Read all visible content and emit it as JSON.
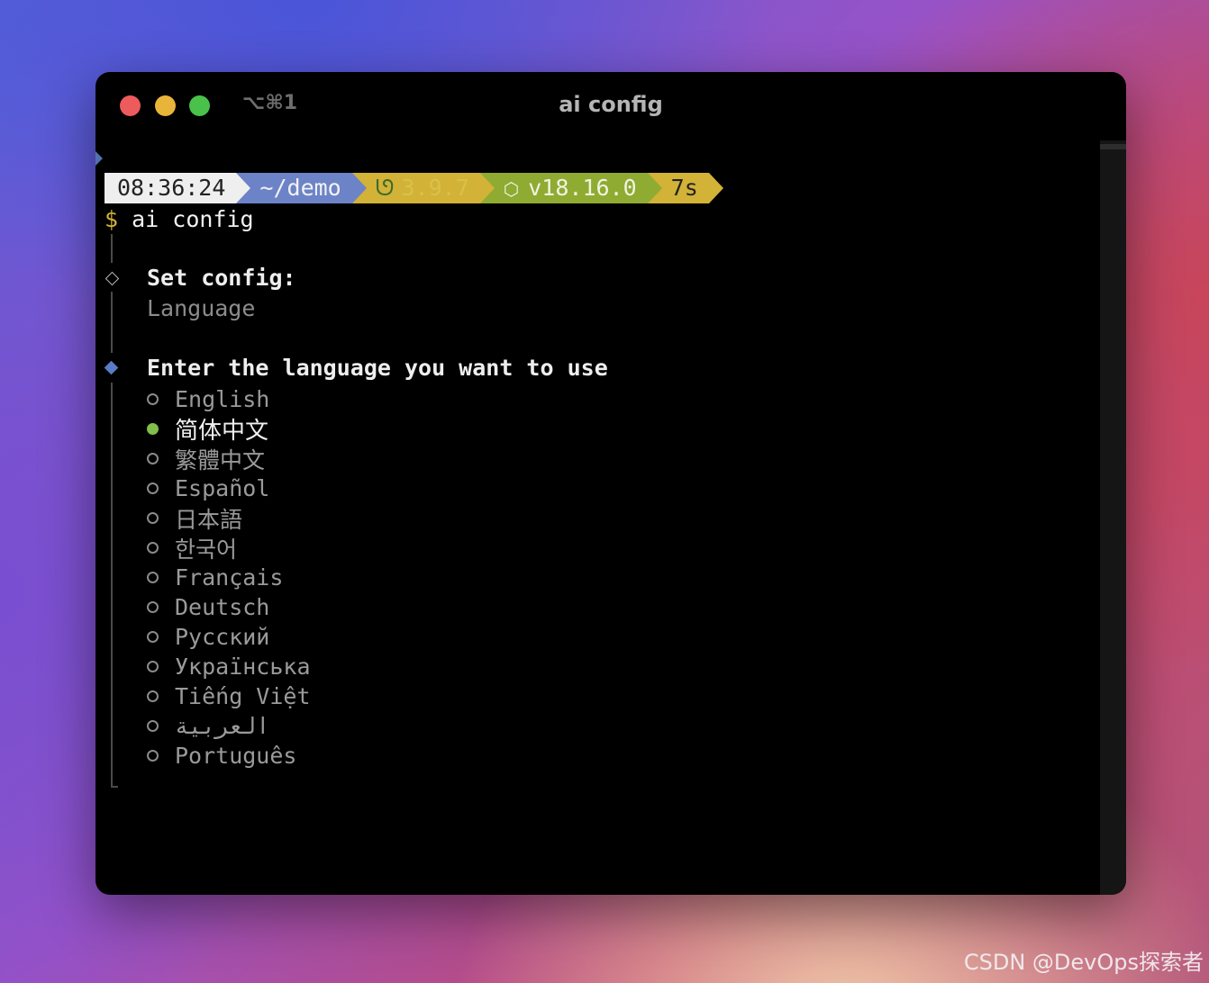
{
  "window": {
    "title": "ai config",
    "shortcut": "⌥⌘1"
  },
  "prompt": {
    "time": "08:36:24",
    "directory": "~/demo",
    "python_version": "3.9.7",
    "node_version": "v18.16.0",
    "duration": "7s"
  },
  "command": {
    "symbol": "$",
    "text": "ai config"
  },
  "config": {
    "heading": "Set config:",
    "value": "Language"
  },
  "language_prompt": {
    "question": "Enter the language you want to use",
    "options": [
      {
        "label": "English",
        "selected": false
      },
      {
        "label": "简体中文",
        "selected": true
      },
      {
        "label": "繁體中文",
        "selected": false
      },
      {
        "label": "Español",
        "selected": false
      },
      {
        "label": "日本語",
        "selected": false
      },
      {
        "label": "한국어",
        "selected": false
      },
      {
        "label": "Français",
        "selected": false
      },
      {
        "label": "Deutsch",
        "selected": false
      },
      {
        "label": "Русский",
        "selected": false
      },
      {
        "label": "Українська",
        "selected": false
      },
      {
        "label": "Tiếng Việt",
        "selected": false
      },
      {
        "label": "العربية",
        "selected": false
      },
      {
        "label": "Português",
        "selected": false
      }
    ]
  },
  "watermark": "CSDN @DevOps探索者",
  "colors": {
    "selected_indicator": "#7fbf4a",
    "active_diamond": "#5a7bc6",
    "prompt_time_bg": "#efefef",
    "prompt_dir_bg": "#6d83c8",
    "prompt_python_bg": "#d2b237",
    "prompt_node_bg": "#8fab32"
  }
}
